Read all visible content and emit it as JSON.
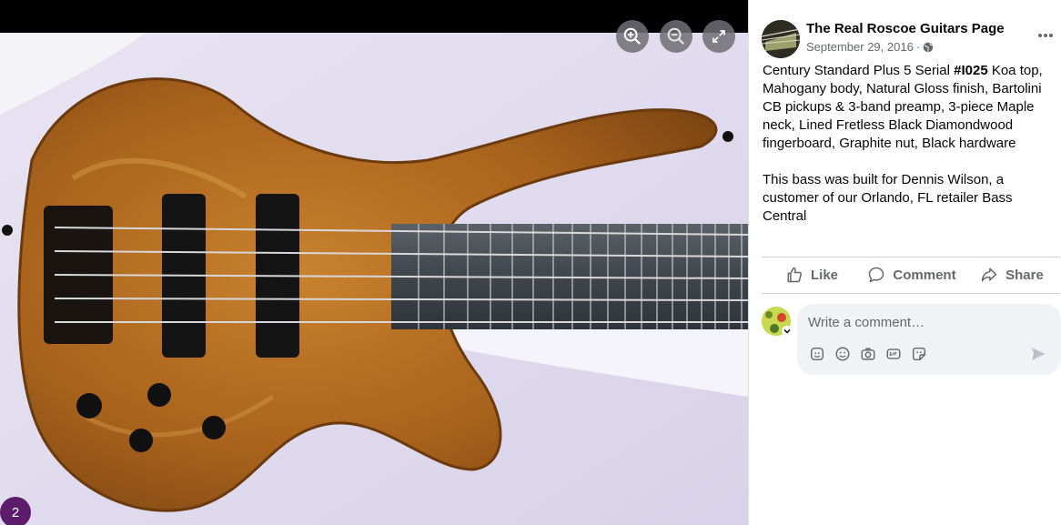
{
  "viewer": {
    "zoom_in_icon": "zoom-in-icon",
    "zoom_out_icon": "zoom-out-icon",
    "fullscreen_icon": "expand-icon",
    "photo_count": "2"
  },
  "post": {
    "page_name": "The Real Roscoe Guitars Page",
    "date": "September 29, 2016",
    "separator": "·",
    "audience_icon": "globe-icon",
    "more_icon": "more-horizontal-icon",
    "caption": {
      "line1_prefix": "Century Standard Plus 5 Serial ",
      "hashtag": "#I025",
      "line1_suffix": " Koa top, Mahogany body, Natural Gloss finish, Bartolini CB pickups & 3-band preamp, 3-piece Maple neck, Lined Fretless Black Diamondwood fingerboard, Graphite nut, Black hardware",
      "paragraph2": "This bass was built for Dennis Wilson, a customer of our Orlando, FL retailer Bass Central"
    }
  },
  "actions": {
    "like": "Like",
    "comment": "Comment",
    "share": "Share"
  },
  "composer": {
    "placeholder": "Write a comment…",
    "icons": [
      "avatar-sticker-icon",
      "emoji-icon",
      "camera-icon",
      "gif-icon",
      "sticker-icon"
    ],
    "send_icon": "send-icon"
  },
  "colors": {
    "accent_badge": "#5b1d6b",
    "wood": "#b06a22",
    "text_secondary": "#65676b"
  }
}
